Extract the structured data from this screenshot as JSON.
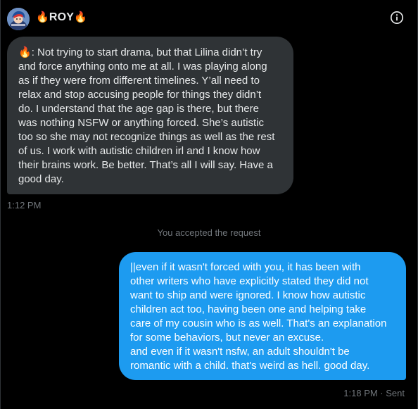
{
  "conversation": {
    "name_prefix_icon": "fire-emoji",
    "name": "ROY",
    "name_suffix_icon": "fire-emoji",
    "info_icon": "info-circle-icon"
  },
  "messages": [
    {
      "direction": "received",
      "lead_icon": "fire-emoji",
      "lines": [
        ": Not trying to start drama, but that Lilina didn’t try",
        "and force anything onto me at all. I was playing along",
        "as if they were from different timelines. Y’all need to",
        "relax and stop accusing people for things they didn’t",
        "do. I understand that the age gap is there, but there",
        "was nothing NSFW or anything forced. She’s autistic",
        "too so she may not recognize things as well as the rest",
        "of us. I work with autistic children irl and I know how",
        "their brains work. Be better. That’s all I will say. Have a",
        "good day."
      ],
      "time": "1:12 PM"
    },
    {
      "direction": "sent",
      "lines": [
        "||even if it wasn't forced with you, it has been with",
        "other writers who have explicitly stated they did not",
        "want to ship and were ignored. I know how autistic",
        "children act too, having been one and helping take",
        "care of my cousin who is as well. That's an explanation",
        "for some behaviors, but never an excuse.",
        "and even if it wasn't nsfw, an adult shouldn't be",
        "romantic with a child. that's weird as hell. good day."
      ],
      "time": "1:18 PM · Sent"
    }
  ],
  "system_note": "You accepted the request",
  "colors": {
    "background": "#000000",
    "received_bubble": "#2f3336",
    "sent_bubble": "#1d9bf0",
    "muted_text": "#71767b",
    "flame": "#f47b20"
  }
}
